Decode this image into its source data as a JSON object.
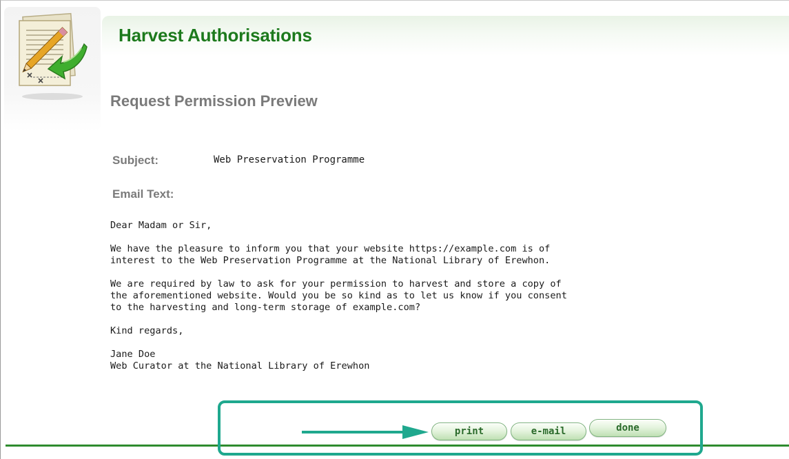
{
  "header": {
    "title": "Harvest Authorisations",
    "subtitle": "Request Permission Preview"
  },
  "form": {
    "subject_label": "Subject:",
    "subject_value": "Web Preservation Programme",
    "email_text_label": "Email Text:"
  },
  "email_body": {
    "greeting": "Dear Madam or Sir,",
    "para1_line1": "We have the pleasure to inform you that your website https://example.com is of",
    "para1_line2": "interest to the Web Preservation Programme at the National Library of Erewhon.",
    "para2_line1": "We are required by law to ask for your permission to harvest and store a copy of",
    "para2_line2": "the aforementioned website. Would you be so kind as to let us know if you consent",
    "para2_line3": "to the harvesting and long-term storage of example.com?",
    "closing": "Kind regards,",
    "signature_name": "Jane Doe",
    "signature_title": "Web Curator at the National Library of Erewhon"
  },
  "actions": {
    "print_label": "print",
    "email_label": "e-mail",
    "done_label": "done"
  },
  "icons": {
    "app_icon": "document-pencil-arrow-icon",
    "annotation_arrow": "arrow-right-icon"
  },
  "colors": {
    "title_green": "#1d7a1d",
    "rule_green": "#2e8b2e",
    "annotation_teal": "#1fa88e",
    "label_gray": "#7a7a7a"
  }
}
